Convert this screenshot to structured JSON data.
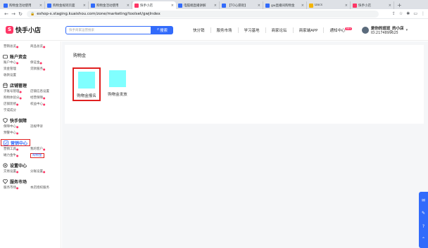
{
  "browser": {
    "tabs": [
      {
        "title": "购物金活动使用",
        "color": "#326bfb",
        "active": false
      },
      {
        "title": "购物金规则页面",
        "color": "#326bfb",
        "active": false
      },
      {
        "title": "购物金活动使用",
        "color": "#326bfb",
        "active": false
      },
      {
        "title": "快手小店",
        "color": "#fe3666",
        "active": true
      },
      {
        "title": "电脑端直播讲解",
        "color": "#326bfb",
        "active": false
      },
      {
        "title": "【TO心愿街】",
        "color": "#326bfb",
        "active": false
      },
      {
        "title": "gw直播间购物金",
        "color": "#326bfb",
        "active": false
      },
      {
        "title": "Docs",
        "color": "#f4b400",
        "active": false
      },
      {
        "title": "快手小店",
        "color": "#fe3666",
        "active": false
      }
    ],
    "new_tab": "+",
    "url": "eshop-s.staging.kuaishou.com/zone/marketing/toolset/gwjIndex"
  },
  "header": {
    "logo_mark": "S",
    "logo_text": "快手小店",
    "search_placeholder": "快手商家运营搜索",
    "search_button": "搜索",
    "nav": [
      "快分销",
      "服务市场",
      "学习基地",
      "商家论坛",
      "商家端APP",
      "通知中心"
    ],
    "notify_badge": "99+",
    "user_name": "是你的班班_的小店",
    "user_id": "ID:2174899625"
  },
  "sidebar": {
    "top_items": [
      {
        "label": "营销总览",
        "dot": true
      },
      {
        "label": "商品总览",
        "dot": true
      }
    ],
    "sections": [
      {
        "title": "账户资金",
        "icon": "wallet-icon",
        "boxed": false,
        "items": [
          {
            "label": "账户中心",
            "dot": true
          },
          {
            "label": "保证金",
            "dot": true
          },
          {
            "label": "资金管理",
            "dot": false
          },
          {
            "label": "贷款服务",
            "dot": true
          },
          {
            "label": "收款设置",
            "dot": false
          }
        ]
      },
      {
        "title": "店铺管理",
        "icon": "store-icon",
        "boxed": false,
        "items": [
          {
            "label": "子账号管理",
            "dot": true
          },
          {
            "label": "店铺信息设置",
            "dot": false
          },
          {
            "label": "购物体验分",
            "dot": true
          },
          {
            "label": "经营保障",
            "dot": true
          },
          {
            "label": "店铺装修",
            "dot": true
          },
          {
            "label": "权益中心",
            "dot": true
          },
          {
            "label": "学成成分",
            "dot": false
          }
        ]
      },
      {
        "title": "快手保障",
        "icon": "shield-icon",
        "boxed": false,
        "items": [
          {
            "label": "保障中心",
            "dot": true
          },
          {
            "label": "违规申诉",
            "dot": false
          },
          {
            "label": "预警中心",
            "dot": true
          }
        ]
      },
      {
        "title": "营销中心",
        "icon": "marketing-icon",
        "boxed": true,
        "items": [
          {
            "label": "营销工具",
            "dot": true
          },
          {
            "label": "我的客户",
            "dot": true
          },
          {
            "label": "磁力金牛",
            "dot": true
          },
          {
            "label": "购物金",
            "dot": false,
            "selected": true
          }
        ]
      },
      {
        "title": "设置中心",
        "icon": "settings-icon",
        "boxed": false,
        "items": [
          {
            "label": "交易设置",
            "dot": true
          },
          {
            "label": "分账设置",
            "dot": true
          }
        ]
      },
      {
        "title": "服务市场",
        "icon": "market-icon",
        "boxed": false,
        "items": [
          {
            "label": "服务市场",
            "dot": true
          },
          {
            "label": "本店授权服务",
            "dot": false
          }
        ]
      }
    ]
  },
  "main": {
    "card_title": "购物金",
    "tools": [
      {
        "label": "购物金报名",
        "boxed": true
      },
      {
        "label": "购物金发放",
        "boxed": false
      }
    ]
  },
  "colors": {
    "brand": "#fe3666",
    "accent": "#326bfb",
    "highlight": "#e02020",
    "tool_tile": "#80ffff"
  }
}
